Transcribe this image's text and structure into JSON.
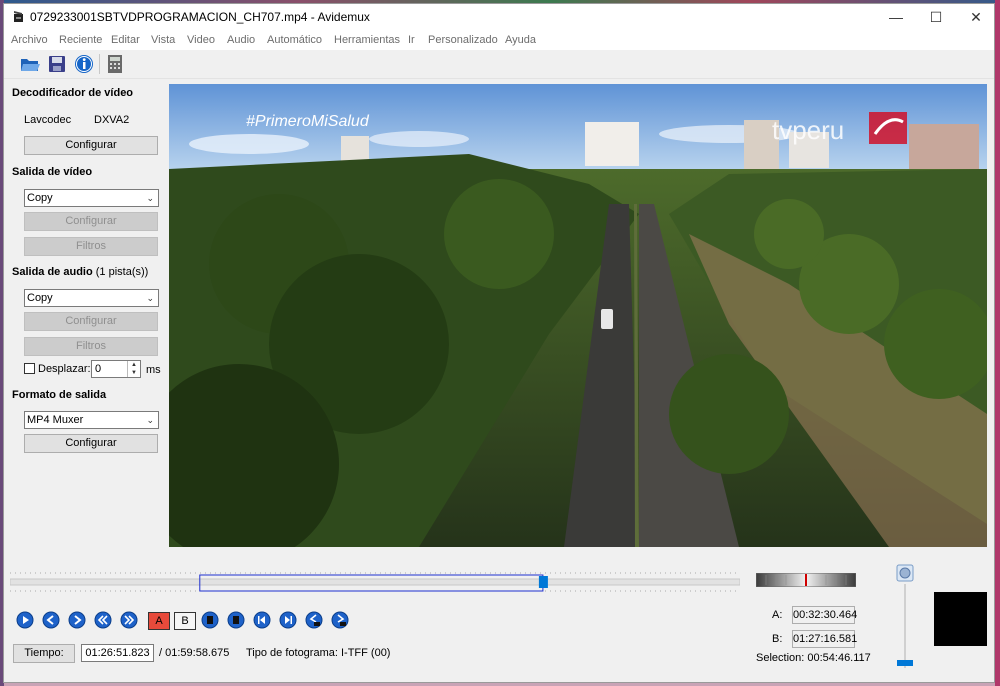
{
  "window": {
    "title": "0729233001SBTVDPROGRAMACION_CH707.mp4 - Avidemux",
    "minimize_glyph": "—",
    "maximize_glyph": "☐",
    "close_glyph": "✕"
  },
  "menu": [
    "Archivo",
    "Reciente",
    "Editar",
    "Vista",
    "Video",
    "Audio",
    "Automático",
    "Herramientas",
    "Ir",
    "Personalizado",
    "Ayuda"
  ],
  "toolbar": {
    "icons": [
      "open-icon",
      "save-icon",
      "info-icon",
      "calculator-icon"
    ]
  },
  "video_decoder": {
    "title": "Decodificador de vídeo",
    "decoder_name": "Lavcodec",
    "decoder_mode": "DXVA2",
    "configure_label": "Configurar"
  },
  "video_output": {
    "title": "Salida de vídeo",
    "codec": "Copy",
    "configure_label": "Configurar",
    "filters_label": "Filtros"
  },
  "audio_output": {
    "title": "Salida de audio",
    "tracks": "(1 pista(s))",
    "codec": "Copy",
    "configure_label": "Configurar",
    "filters_label": "Filtros",
    "shift_label": "Desplazar:",
    "shift_value": "0",
    "shift_unit": "ms"
  },
  "output_format": {
    "title": "Formato de salida",
    "muxer": "MP4 Muxer",
    "configure_label": "Configurar"
  },
  "video_overlay": {
    "hashtag": "#PrimeroMiSalud",
    "logo": "tvperu"
  },
  "navigation": {
    "buttons": [
      "play-icon",
      "rewind-icon",
      "forward-icon",
      "prev-keyframe-icon",
      "next-keyframe-icon",
      "set-marker-a-icon",
      "set-marker-b-icon",
      "prev-black-icon",
      "next-black-icon",
      "goto-start-icon",
      "goto-end-icon",
      "goto-marker-a-icon",
      "goto-marker-b-icon"
    ],
    "marker_a_glyph": "A",
    "marker_b_glyph": "B"
  },
  "timeline": {
    "selection_start_fraction": 0.26,
    "selection_end_fraction": 0.73,
    "cursor_fraction": 0.73
  },
  "status": {
    "time_button": "Tiempo:",
    "current_time": "01:26:51.823",
    "total_time": "/ 01:59:58.675",
    "frame_type": "Tipo de fotograma:  I-TFF (00)"
  },
  "markers": {
    "a_label": "A:",
    "a_value": "00:32:30.464",
    "b_label": "B:",
    "b_value": "01:27:16.581",
    "selection": "Selection: 00:54:46.117"
  },
  "volume": {
    "level_fraction": 0.05
  },
  "colors": {
    "accent": "#0078d7",
    "selection_border": "#1e2fcf",
    "marker_red": "#d00000"
  }
}
